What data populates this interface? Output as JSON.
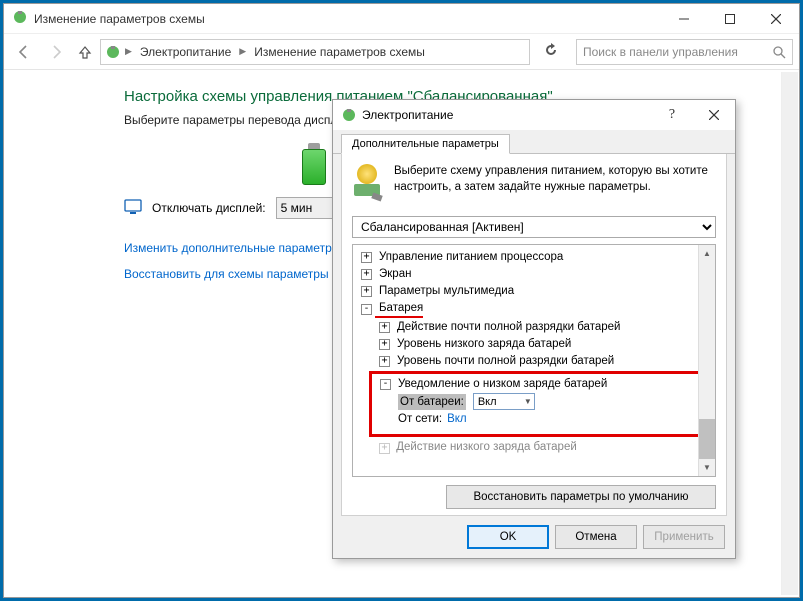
{
  "window": {
    "title": "Изменение параметров схемы"
  },
  "breadcrumb": {
    "item1": "Электропитание",
    "item2": "Изменение параметров схемы"
  },
  "search": {
    "placeholder": "Поиск в панели управления"
  },
  "page": {
    "heading": "Настройка схемы управления питанием \"Сбалансированная\"",
    "subheading": "Выберите параметры перевода дисплея",
    "turn_off_label": "Отключать дисплей:",
    "turn_off_value": "5 мин",
    "link_advanced": "Изменить дополнительные параметры",
    "link_restore": "Восстановить для схемы параметры по"
  },
  "dialog": {
    "title": "Электропитание",
    "tab": "Дополнительные параметры",
    "desc": "Выберите схему управления питанием, которую вы хотите настроить, а затем задайте нужные параметры.",
    "plan": "Сбалансированная [Активен]",
    "restore_button": "Восстановить параметры по умолчанию",
    "ok": "OK",
    "cancel": "Отмена",
    "apply": "Применить"
  },
  "tree": {
    "cpu": "Управление питанием процессора",
    "screen": "Экран",
    "multimedia": "Параметры мультимедиа",
    "battery": "Батарея",
    "action_critical": "Действие почти полной разрядки батарей",
    "low_level": "Уровень низкого заряда батарей",
    "critical_level": "Уровень почти полной разрядки батарей",
    "notify": "Уведомление о низком заряде батарей",
    "on_battery_label": "От батареи:",
    "on_battery_value": "Вкл",
    "on_ac_label": "От сети:",
    "on_ac_value": "Вкл",
    "low_action": "Действие низкого заряда батарей"
  }
}
